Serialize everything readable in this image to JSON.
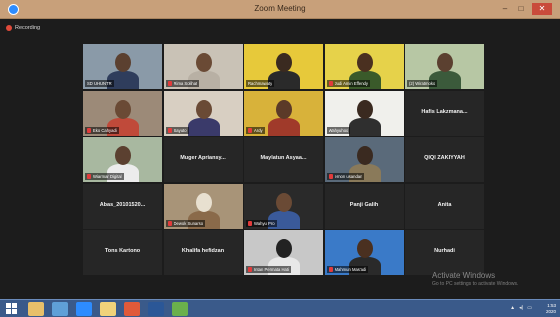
{
  "window": {
    "title": "Zoom Meeting",
    "min_label": "–",
    "max_label": "□",
    "close_label": "✕"
  },
  "recording": {
    "label": "Recording",
    "color": "#e04a3a"
  },
  "participants": [
    {
      "name": "SD UHUNTR",
      "video": true,
      "muted": false
    },
    {
      "name": "Rima Solihat",
      "video": true,
      "muted": true
    },
    {
      "name": "Rachmawaty",
      "video": true,
      "muted": false
    },
    {
      "name": "Judi Amin Effendy",
      "video": true,
      "muted": true
    },
    {
      "name": "(2) Wiratmoko",
      "video": true,
      "muted": false
    },
    {
      "name": "Eko Cahyadi",
      "video": true,
      "muted": true
    },
    {
      "name": "Sayuto",
      "video": true,
      "muted": true
    },
    {
      "name": "Ardy",
      "video": true,
      "muted": true
    },
    {
      "name": "Wahyuhoo",
      "video": true,
      "muted": false,
      "active": true
    },
    {
      "name": "Hafis Lakzmana...",
      "video": false,
      "muted": false
    },
    {
      "name": "Wiarmar Digital",
      "video": true,
      "muted": true
    },
    {
      "name": "Muger Apriansy...",
      "video": false,
      "muted": false
    },
    {
      "name": "Maylatun Asyaa...",
      "video": false,
      "muted": false
    },
    {
      "name": "ernon usandan",
      "video": true,
      "muted": true
    },
    {
      "name": "QIQI ZAKIYYAH",
      "video": false,
      "muted": false
    },
    {
      "name": "Abas_20101520...",
      "video": false,
      "muted": false
    },
    {
      "name": "Dewok Sunarso",
      "video": true,
      "muted": true
    },
    {
      "name": "Wahyu Pro",
      "video": true,
      "muted": true
    },
    {
      "name": "Panji Galih",
      "video": false,
      "muted": false
    },
    {
      "name": "Anita",
      "video": false,
      "muted": false
    },
    {
      "name": "Tons Kartono",
      "video": false,
      "muted": false
    },
    {
      "name": "Khalifa hefidzan",
      "video": false,
      "muted": false
    },
    {
      "name": "Intan Permata Hati",
      "video": true,
      "muted": true
    },
    {
      "name": "Mahmun Mas'adi",
      "video": true,
      "muted": true
    },
    {
      "name": "Nurhadi",
      "video": false,
      "muted": false
    }
  ],
  "watermark": {
    "title": "Activate Windows",
    "subtitle": "Go to PC settings to activate Windows."
  },
  "taskbar": {
    "apps": [
      "start-icon",
      "file-explorer-icon",
      "browser-icon",
      "zoom-icon",
      "folder-icon",
      "chrome-icon",
      "word-icon",
      "photos-icon"
    ],
    "time": "1:53",
    "date": "2020"
  },
  "colors": {
    "accent": "#2d8cff",
    "active_speaker": "#c6e64c",
    "muted": "#e23b3b",
    "tile_bg": "#262626"
  }
}
